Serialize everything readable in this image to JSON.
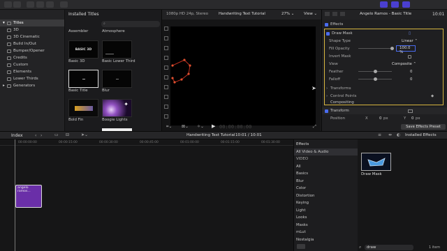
{
  "toolbar": {
    "timecode": "10:01"
  },
  "sidebar": {
    "items": [
      {
        "label": "Titles"
      },
      {
        "label": "3D"
      },
      {
        "label": "3D Cinematic"
      },
      {
        "label": "Build In/Out"
      },
      {
        "label": "Bumper/Opener"
      },
      {
        "label": "Credits"
      },
      {
        "label": "Custom"
      },
      {
        "label": "Elements"
      },
      {
        "label": "Lower Thirds"
      },
      {
        "label": "Generators"
      }
    ]
  },
  "browser": {
    "header": "Installed Titles",
    "top_labels": [
      "Assembler",
      "Atmosphere"
    ],
    "thumbs": [
      {
        "label": "Basic 3D",
        "text": "BASIC 3D"
      },
      {
        "label": "Basic Lower Third",
        "text": ""
      },
      {
        "label": "Basic Title",
        "text": ""
      },
      {
        "label": "Blur",
        "text": ""
      },
      {
        "label": "Bold Fin",
        "text": ""
      },
      {
        "label": "Boogie Lights",
        "text": ""
      }
    ]
  },
  "viewer": {
    "format": "1080p HD 24p, Stereo",
    "title": "Handwriting Text Tutorial",
    "zoom": "27%",
    "view_label": "View",
    "timecode": "00:00:00:00"
  },
  "inspector": {
    "clip_name": "Angelo Ramos - Basic Title",
    "timecode": "10:01",
    "effects_label": "Effects",
    "draw_mask": "Draw Mask",
    "rows": [
      {
        "label": "Shape Type",
        "value": "Linear"
      },
      {
        "label": "Fill Opacity",
        "value": "100.0",
        "unit": "%"
      },
      {
        "label": "Invert Mask",
        "value": ""
      },
      {
        "label": "View",
        "value": "Composite"
      },
      {
        "label": "Feather",
        "value": "0"
      },
      {
        "label": "Falloff",
        "value": "0"
      },
      {
        "label": "Transforms",
        "value": ""
      },
      {
        "label": "Control Points",
        "value": ""
      }
    ],
    "compositing": "Compositing",
    "transform": "Transform",
    "position_label": "Position",
    "x_label": "X",
    "x_value": "0",
    "x_unit": "px",
    "y_label": "Y",
    "y_value": "0",
    "y_unit": "px",
    "save_preset": "Save Effects Preset"
  },
  "timebar": {
    "index": "Index",
    "project": "Handwriting Text Tutorial",
    "duration": "10:01 / 10:01",
    "effects_label": "Installed Effects"
  },
  "timeline": {
    "ruler": [
      "00:00:00:00",
      "00:00:15:00",
      "00:00:30:00",
      "00:00:45:00",
      "00:01:00:00",
      "00:01:15:00",
      "00:01:30:00"
    ],
    "clip_label": "angelo ramos..."
  },
  "effects": {
    "header": "Effects",
    "items": [
      "All Video & Audio",
      "VIDEO",
      "All",
      "Basics",
      "Blur",
      "Color",
      "Distortion",
      "Keying",
      "Light",
      "Looks",
      "Masks",
      "mLut",
      "Nostalgia"
    ],
    "search_value": "draw",
    "count": "1 item",
    "result": "Draw Mask"
  },
  "colors": {
    "accent": "#4a3fd0",
    "clip": "#6a2fa8",
    "selection_border": "#d8b640"
  }
}
